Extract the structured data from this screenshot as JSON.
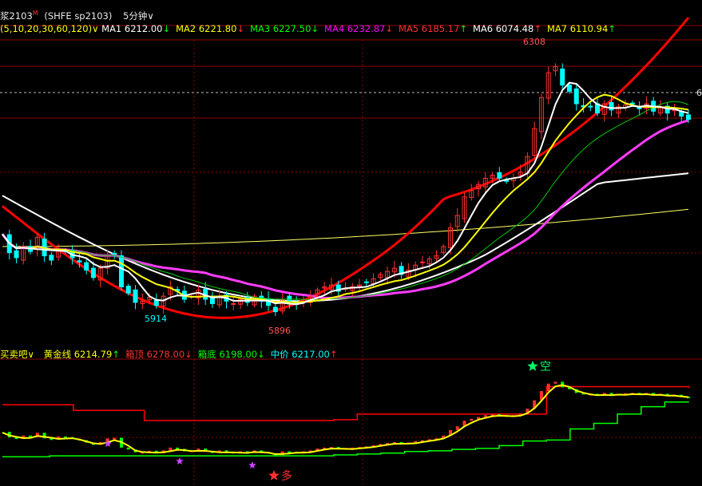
{
  "header": {
    "symbol": "浆2103",
    "symbol_mark": "M",
    "exchange_code": "(SHFE  sp2103)",
    "period": "5分钟",
    "period_arrow": "∨"
  },
  "ma_line": {
    "params": "(5,10,20,30,60,120)",
    "params_arrow": "∨",
    "items": [
      {
        "label": "MA1 6212.00",
        "arrow": "↓",
        "color": "#ffffff"
      },
      {
        "label": "MA2 6221.80",
        "arrow": "↓",
        "color": "#ffff00"
      },
      {
        "label": "MA3 6227.50",
        "arrow": "↓",
        "color": "#00ff00"
      },
      {
        "label": "MA4 6232.87",
        "arrow": "↓",
        "color": "#ff00ff"
      },
      {
        "label": "MA5 6185.17",
        "arrow": "↑",
        "color": "#ff3030"
      },
      {
        "label": "MA6 6074.48",
        "arrow": "↑",
        "color": "#ffffff"
      },
      {
        "label": "MA7 6110.94",
        "arrow": "↑",
        "color": "#ffff00"
      }
    ]
  },
  "sub_line": {
    "name": "买卖吧",
    "name_arrow": "∨",
    "items": [
      {
        "label": "黄金线 6214.79",
        "arrow": "↑",
        "color": "#ffff00"
      },
      {
        "label": "箱顶 6278.00",
        "arrow": "↓",
        "color": "#ff3030"
      },
      {
        "label": "箱底 6198.00",
        "arrow": "↓",
        "color": "#00ff00"
      },
      {
        "label": "中价 6217.00",
        "arrow": "↑",
        "color": "#00ffff"
      }
    ]
  },
  "annotations": {
    "high": "6308",
    "low1": "5914",
    "low2": "5896",
    "right_edge": "6",
    "sell_signal": "空",
    "buy_signal": "多"
  },
  "colors": {
    "up": "#ff3030",
    "down": "#00ffff",
    "ma_white": "#ffffff",
    "ma_yellow": "#ffff00",
    "ma_green": "#00c800",
    "ma_magenta": "#ff3cff",
    "ma_red": "#ff0000",
    "grid": "#8b0000",
    "box_top": "#ff0000",
    "box_bottom": "#00ff00",
    "star_magenta": "#cc44ff"
  },
  "chart_data": {
    "type": "candlestick",
    "main_ylim": [
      5880,
      6330
    ],
    "main_price_series": [
      6030,
      6000,
      5992,
      6010,
      6002,
      6025,
      5995,
      5988,
      6005,
      6002,
      5992,
      5985,
      5972,
      5960,
      5975,
      5995,
      5998,
      5945,
      5935,
      5920,
      5922,
      5928,
      5915,
      5930,
      5945,
      5938,
      5925,
      5930,
      5940,
      5925,
      5918,
      5930,
      5922,
      5918,
      5925,
      5920,
      5930,
      5922,
      5915,
      5905,
      5925,
      5922,
      5918,
      5925,
      5930,
      5940,
      5945,
      5948,
      5938,
      5942,
      5945,
      5948,
      5952,
      5958,
      5965,
      5970,
      5975,
      5965,
      5972,
      5980,
      5985,
      5990,
      5995,
      6010,
      6040,
      6060,
      6090,
      6100,
      6110,
      6120,
      6125,
      6120,
      6115,
      6120,
      6130,
      6155,
      6200,
      6250,
      6290,
      6300,
      6270,
      6260,
      6240,
      6235,
      6235,
      6225,
      6240,
      6230,
      6235,
      6238,
      6240,
      6232,
      6240,
      6228,
      6235,
      6225,
      6230,
      6220,
      6215
    ],
    "sub_ylim": [
      5880,
      6330
    ],
    "box_top": [
      6180,
      6180,
      6180,
      6150,
      6150,
      6150,
      6095,
      6095,
      6095,
      6095,
      6095,
      6095,
      6095,
      6095,
      6100,
      6130,
      6130,
      6130,
      6130,
      6130,
      6130,
      6130,
      6130,
      6278,
      6278,
      6278,
      6278,
      6278,
      6278,
      6270
    ],
    "box_bottom": [
      5900,
      5900,
      5905,
      5905,
      5905,
      5905,
      5905,
      5905,
      5905,
      5905,
      5905,
      5905,
      5905,
      5905,
      5910,
      5915,
      5920,
      5928,
      5932,
      5940,
      5945,
      5960,
      5985,
      5990,
      6050,
      6080,
      6130,
      6170,
      6195,
      6198
    ]
  }
}
